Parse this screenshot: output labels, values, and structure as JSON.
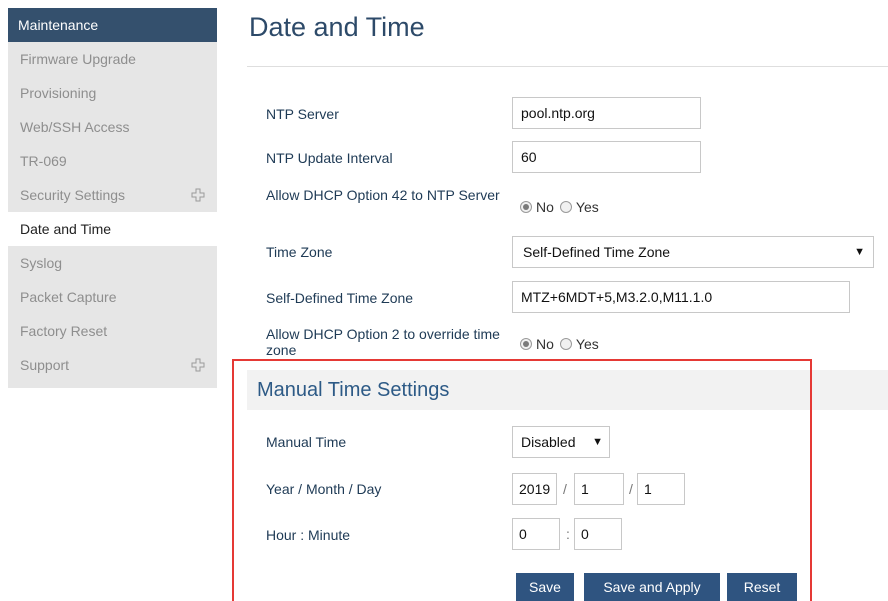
{
  "sidebar": {
    "header": "Maintenance",
    "items": [
      {
        "label": "Firmware Upgrade"
      },
      {
        "label": "Provisioning"
      },
      {
        "label": "Web/SSH Access"
      },
      {
        "label": "TR-069"
      },
      {
        "label": "Security Settings",
        "expandable": true
      },
      {
        "label": "Date and Time",
        "active": true
      },
      {
        "label": "Syslog"
      },
      {
        "label": "Packet Capture"
      },
      {
        "label": "Factory Reset"
      },
      {
        "label": "Support",
        "expandable": true
      }
    ]
  },
  "page": {
    "title": "Date and Time"
  },
  "form": {
    "ntp_server": {
      "label": "NTP Server",
      "value": "pool.ntp.org"
    },
    "ntp_interval": {
      "label": "NTP Update Interval",
      "value": "60"
    },
    "dhcp42": {
      "label": "Allow DHCP Option 42 to NTP Server",
      "options": [
        "No",
        "Yes"
      ],
      "selected": "No"
    },
    "timezone": {
      "label": "Time Zone",
      "value": "Self-Defined Time Zone"
    },
    "self_defined_tz": {
      "label": "Self-Defined Time Zone",
      "value": "MTZ+6MDT+5,M3.2.0,M11.1.0"
    },
    "dhcp2": {
      "label": "Allow DHCP Option 2 to override time zone",
      "options": [
        "No",
        "Yes"
      ],
      "selected": "No"
    }
  },
  "manual": {
    "title": "Manual Time Settings",
    "manual_time": {
      "label": "Manual Time",
      "value": "Disabled"
    },
    "date": {
      "label": "Year / Month / Day",
      "year": "2019",
      "month": "1",
      "day": "1",
      "sep": "/"
    },
    "time": {
      "label": "Hour : Minute",
      "hour": "0",
      "minute": "0",
      "sep": ":"
    }
  },
  "buttons": {
    "save": "Save",
    "save_apply": "Save and Apply",
    "reset": "Reset"
  },
  "colors": {
    "sidebar_header": "#34506d",
    "button": "#2f5480",
    "highlight_border": "#e53935"
  }
}
